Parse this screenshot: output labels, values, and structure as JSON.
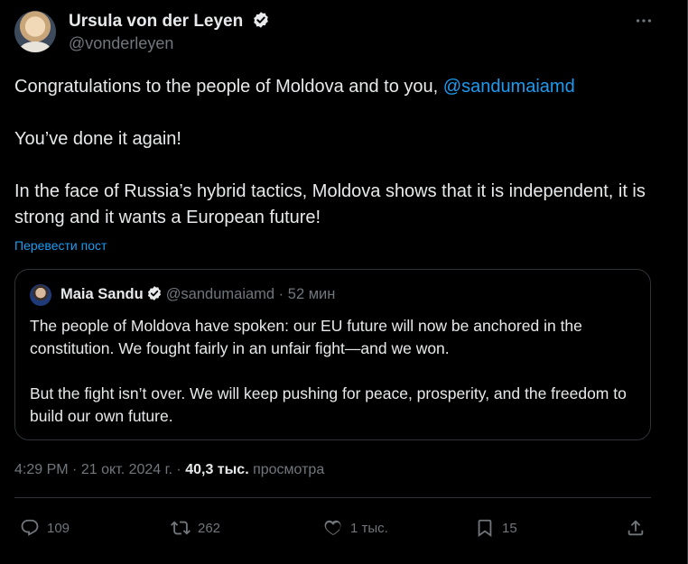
{
  "author": {
    "name": "Ursula von der Leyen",
    "handle": "@vonderleyen"
  },
  "tweet": {
    "line1_prefix": "Congratulations to the people of Moldova and to you, ",
    "line1_mention": "@sandumaiamd",
    "line2": "You’ve done it again!",
    "line3": "In the face of Russia’s hybrid tactics, Moldova shows that it is independent, it is strong and it wants a European future!",
    "translate_label": "Перевести пост"
  },
  "quoted": {
    "name": "Maia Sandu",
    "handle": "@sandumaiamd",
    "separator": "·",
    "time": "52 мин",
    "paragraph1": "The people of Moldova have spoken: our EU future will now be anchored in the constitution. We fought fairly in an unfair fight—and we won.",
    "paragraph2": "But the fight isn’t over. We will keep pushing for peace, prosperity, and the freedom to build our own future."
  },
  "meta": {
    "time": "4:29 PM",
    "date": "21 окт. 2024 г.",
    "views_count": "40,3 тыс.",
    "views_label": "просмотра"
  },
  "actions": {
    "replies": "109",
    "reposts": "262",
    "likes": "1 тыс.",
    "bookmarks": "15"
  },
  "colors": {
    "background": "#000000",
    "text": "#e7e9ea",
    "muted": "#71767b",
    "accent": "#1d9bf0",
    "border": "#2f3336"
  },
  "icons": [
    "verified-icon",
    "more-icon",
    "reply-icon",
    "repost-icon",
    "like-icon",
    "bookmark-icon",
    "share-icon"
  ]
}
